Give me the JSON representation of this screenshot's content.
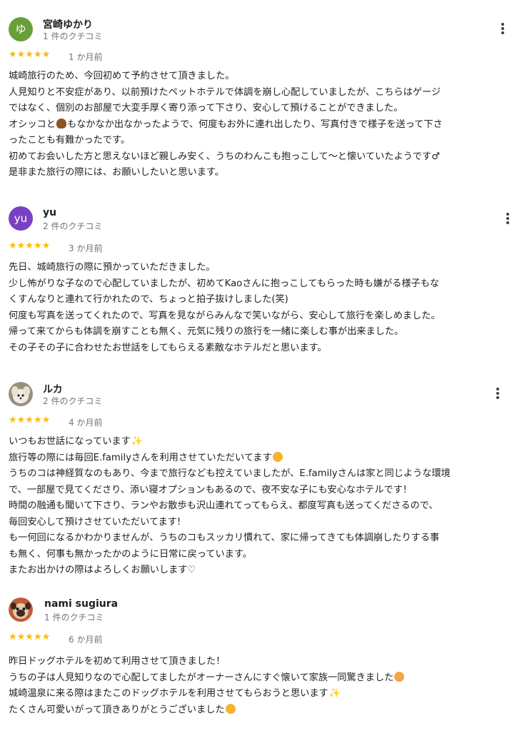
{
  "reviews": [
    {
      "name": "宮崎ゆかり",
      "avatar_text": "ゆ",
      "avatar_color": "#689f38",
      "count": "1 件のクチコミ",
      "stars": "★★★★★",
      "when": "1 か月前",
      "lines": [
        "城崎旅行のため、今回初めて予約させて頂きました。",
        "人見知りと不安症があり、以前預けたペットホテルで体調を崩し心配していましたが、こちらはゲージ",
        "ではなく、個別のお部屋で大変手厚く寄り添って下さり、安心して預けることができました。",
        "オシッコと",
        "もなかなか出なかったようで、何度もお外に連れ出したり、写真付きで様子を送って下さ",
        "ったことも有難かったです。",
        "初めてお会いした方と思えないほど親しみ安く、うちのわんこも抱っこして〜と懐いていたようです♂",
        "是非また旅行の際には、お願いしたいと思います。"
      ]
    },
    {
      "name": "yu",
      "avatar_text": "yu",
      "avatar_color": "#7b3fc4",
      "count": "2 件のクチコミ",
      "stars": "★★★★★",
      "when": "3 か月前",
      "lines": [
        "先日、城崎旅行の際に預かっていただきました。",
        "少し怖がりな子なので心配していましたが、初めてKaoさんに抱っこしてもらった時も嫌がる様子もな",
        "くすんなりと連れて行かれたので、ちょっと拍子抜けしました(笑)",
        "何度も写真を送ってくれたので、写真を見ながらみんなで笑いながら、安心して旅行を楽しめました。",
        "帰って来てからも体調を崩すことも無く、元気に残りの旅行を一緒に楽しむ事が出来ました。",
        "その子その子に合わせたお世話をしてもらえる素敵なホテルだと思います。"
      ]
    },
    {
      "name": "ルカ",
      "avatar_text": "",
      "avatar_color": "#a08a6e",
      "count": "2 件のクチコミ",
      "stars": "★★★★★",
      "when": "4 か月前",
      "lines": [
        "いつもお世話になっています",
        "旅行等の際には毎回E.familyさんを利用させていただいてます",
        "うちのコは神経質なのもあり、今まで旅行なども控えていましたが、E.familyさんは家と同じような環境",
        "で、一部屋で見てくださり、添い寝オプションもあるので、夜不安な子にも安心なホテルです！",
        "時間の融通も聞いて下さり、ランやお散歩も沢山連れてってもらえ、都度写真も送ってくださるので、",
        "毎回安心して預けさせていただいてます!",
        "も一何回になるかわかりませんが、うちのコもスッカリ慣れて、家に帰ってきても体調崩したりする事",
        "も無く、何事も無かったかのように日常に戻っています。",
        "またお出かけの際はよろしくお願いします♡"
      ]
    },
    {
      "name": "nami sugiura",
      "avatar_text": "",
      "avatar_color": "#c97b5a",
      "count": "1 件のクチコミ",
      "stars": "★★★★★",
      "when": "6 か月前",
      "lines": [
        "昨日ドッグホテルを初めて利用させて頂きました！",
        "うちの子は人見知りなので心配してましたがオーナーさんにすぐ懐いて家族一同驚きました",
        "城崎温泉に来る際はまたこのドッグホテルを利用させてもらおうと思います",
        "たくさん可愛いがって頂きありがとうございました"
      ]
    }
  ]
}
